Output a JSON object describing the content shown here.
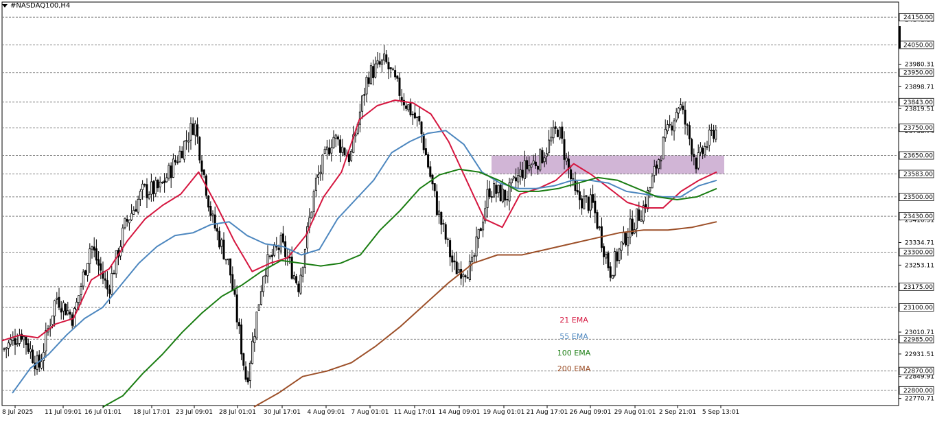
{
  "window_title": "#NASDAQ100,H4",
  "colors": {
    "background": "#ffffff",
    "grid": "#808080",
    "candle": "#000000",
    "zone": "#c9a8cf",
    "ema21": "#d5163f",
    "ema55": "#4d87bf",
    "ema100": "#1a7d12",
    "ema200": "#9c4f28"
  },
  "chart_data": {
    "type": "candlestick",
    "symbol": "#NASDAQ100",
    "timeframe": "H4",
    "ylim": [
      22745,
      24205
    ],
    "x_tick_labels": [
      "8 Jul 2025",
      "11 Jul 09:01",
      "16 Jul 01:01",
      "18 Jul 17:01",
      "23 Jul 09:01",
      "28 Jul 01:01",
      "30 Jul 17:01",
      "4 Aug 09:01",
      "7 Aug 01:01",
      "11 Aug 17:01",
      "14 Aug 09:01",
      "19 Aug 01:01",
      "21 Aug 17:01",
      "26 Aug 09:01",
      "29 Aug 01:01",
      "2 Sep 21:01",
      "5 Sep 13:01"
    ],
    "y_tick_labels": [
      "24141.11",
      "23980.31",
      "23898.71",
      "23819.51",
      "23738.74",
      "23416.31",
      "23334.71",
      "23253.11",
      "23010.71",
      "22931.51",
      "22849.91",
      "22770.71"
    ],
    "y_tick_values": [
      24141.11,
      23980.31,
      23898.71,
      23819.51,
      23738.74,
      23416.31,
      23334.71,
      23253.11,
      23010.71,
      22931.51,
      22849.91,
      22770.71
    ],
    "horizontal_levels": [
      "24150.00",
      "24050.00",
      "23950.00",
      "23843.00",
      "23750.00",
      "23650.00",
      "23583.00",
      "23500.00",
      "23430.00",
      "23300.00",
      "23175.00",
      "23100.00",
      "22985.00",
      "22870.00",
      "22800.00"
    ],
    "level_values": [
      24150,
      24050,
      23950,
      23843,
      23750,
      23650,
      23583,
      23500,
      23430,
      23300,
      23175,
      23100,
      22985,
      22870,
      22800
    ],
    "zone": {
      "from_date": "19 Aug",
      "to_date": "5 Sep",
      "low": 23583,
      "high": 23650
    },
    "close_path": [
      {
        "t": "8 Jul 2025",
        "v": 22950
      },
      {
        "t": "11 Jul 09:01",
        "v": 23010
      },
      {
        "t": "14 Jul",
        "v": 22880
      },
      {
        "t": "15 Jul",
        "v": 23140
      },
      {
        "t": "16 Jul 01:01",
        "v": 23060
      },
      {
        "t": "18 Jul 17:01",
        "v": 23330
      },
      {
        "t": "21 Jul",
        "v": 23160
      },
      {
        "t": "23 Jul 09:01",
        "v": 23400
      },
      {
        "t": "25 Jul",
        "v": 23520
      },
      {
        "t": "28 Jul 01:01",
        "v": 23530
      },
      {
        "t": "29 Jul",
        "v": 23640
      },
      {
        "t": "30 Jul",
        "v": 23770
      },
      {
        "t": "30 Jul 17:01",
        "v": 23420
      },
      {
        "t": "31 Jul",
        "v": 23250
      },
      {
        "t": "1 Aug",
        "v": 22830
      },
      {
        "t": "4 Aug 09:01",
        "v": 23240
      },
      {
        "t": "5 Aug",
        "v": 23330
      },
      {
        "t": "6 Aug",
        "v": 23180
      },
      {
        "t": "7 Aug 01:01",
        "v": 23550
      },
      {
        "t": "8 Aug",
        "v": 23720
      },
      {
        "t": "11 Aug 17:01",
        "v": 23640
      },
      {
        "t": "12 Aug",
        "v": 23940
      },
      {
        "t": "13 Aug",
        "v": 23990
      },
      {
        "t": "14 Aug 09:01",
        "v": 23860
      },
      {
        "t": "15 Aug",
        "v": 23760
      },
      {
        "t": "19 Aug 01:01",
        "v": 23460
      },
      {
        "t": "20 Aug",
        "v": 23240
      },
      {
        "t": "21 Aug 17:01",
        "v": 23240
      },
      {
        "t": "22 Aug",
        "v": 23530
      },
      {
        "t": "25 Aug",
        "v": 23500
      },
      {
        "t": "26 Aug 09:01",
        "v": 23600
      },
      {
        "t": "27 Aug",
        "v": 23640
      },
      {
        "t": "28 Aug",
        "v": 23750
      },
      {
        "t": "29 Aug 01:01",
        "v": 23500
      },
      {
        "t": "1 Sep",
        "v": 23470
      },
      {
        "t": "2 Sep",
        "v": 23230
      },
      {
        "t": "2 Sep 21:01",
        "v": 23370
      },
      {
        "t": "3 Sep",
        "v": 23470
      },
      {
        "t": "4 Sep",
        "v": 23680
      },
      {
        "t": "5 Sep",
        "v": 23840
      },
      {
        "t": "5 Sep 13:01",
        "v": 23620
      },
      {
        "t": "5 Sep 17:01",
        "v": 23740
      }
    ],
    "series": [
      {
        "name": "21 EMA",
        "values": [
          22980,
          23000,
          22990,
          23040,
          23060,
          23200,
          23240,
          23340,
          23420,
          23470,
          23510,
          23590,
          23470,
          23340,
          23230,
          23260,
          23280,
          23360,
          23500,
          23590,
          23780,
          23830,
          23850,
          23840,
          23800,
          23700,
          23560,
          23420,
          23390,
          23510,
          23530,
          23560,
          23620,
          23580,
          23530,
          23480,
          23460,
          23460,
          23520,
          23560,
          23590
        ]
      },
      {
        "name": "55 EMA",
        "values": [
          22790,
          22880,
          22930,
          23000,
          23060,
          23100,
          23180,
          23260,
          23320,
          23360,
          23370,
          23400,
          23410,
          23360,
          23330,
          23320,
          23290,
          23310,
          23420,
          23490,
          23560,
          23660,
          23700,
          23730,
          23740,
          23690,
          23590,
          23550,
          23530,
          23530,
          23540,
          23560,
          23560,
          23550,
          23520,
          23510,
          23500,
          23500,
          23540,
          23560
        ]
      },
      {
        "name": "100 EMA",
        "values": [
          22740,
          22780,
          22860,
          22930,
          23010,
          23080,
          23140,
          23180,
          23230,
          23270,
          23260,
          23250,
          23260,
          23290,
          23380,
          23450,
          23530,
          23580,
          23600,
          23590,
          23560,
          23520,
          23520,
          23530,
          23550,
          23570,
          23560,
          23530,
          23500,
          23490,
          23500,
          23530
        ]
      },
      {
        "name": "200 EMA",
        "values": [
          22740,
          22790,
          22850,
          22870,
          22900,
          22960,
          23030,
          23110,
          23190,
          23260,
          23290,
          23290,
          23310,
          23330,
          23350,
          23370,
          23380,
          23380,
          23390,
          23410
        ]
      }
    ],
    "legend": [
      "21 EMA",
      "55 EMA",
      "100 EMA",
      "200 EMA"
    ]
  }
}
